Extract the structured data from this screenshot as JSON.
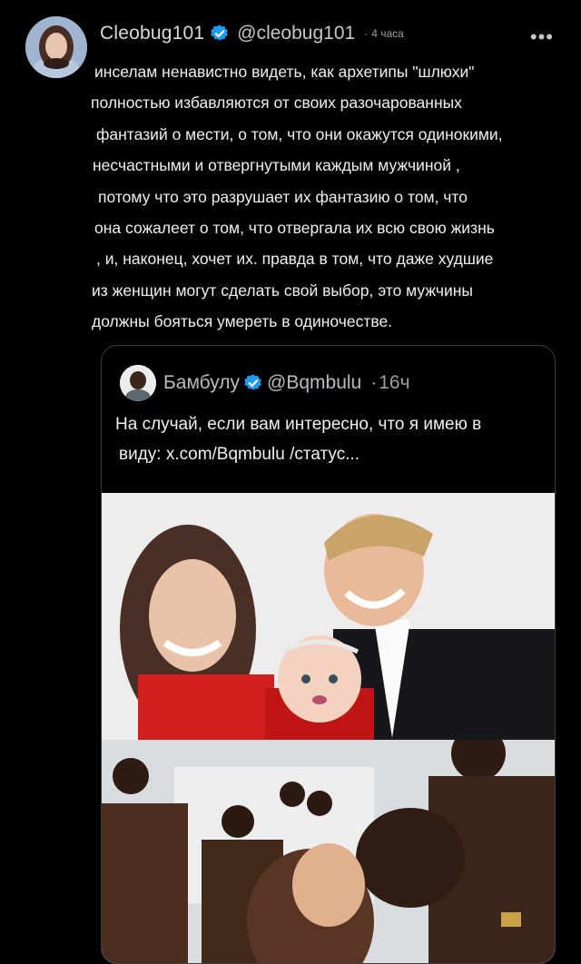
{
  "tweet": {
    "author_name": "Cleobug101",
    "author_handle": "@cleobug101",
    "separator": "·",
    "time": "4 часа",
    "more": "•••",
    "text_lines": [
      "инселам ненавистно видеть, как архетипы \"шлюхи\"",
      "полностью избавляются от своих разочарованных",
      "фантазий о мести, о том, что они окажутся одинокими,",
      "несчастными и отвергнутыми каждым мужчиной ,",
      "потому что это разрушает их фантазию о том, что",
      "она сожалеет о том, что отвергала их всю свою жизнь",
      ", и, наконец, хочет их. правда в том, что даже худшие",
      "из женщин могут сделать свой выбор, это мужчины",
      "должны бояться умереть в одиночестве."
    ]
  },
  "quote": {
    "author_name": "Бамбулу",
    "author_handle": "@Bqmbulu",
    "separator": "·",
    "time": "16ч",
    "text_lines": [
      "На случай, если вам интересно, что я имею в",
      "виду: x.com/Bqmbulu /статус..."
    ]
  },
  "icons": {
    "verified_color": "#1d9bf0"
  }
}
